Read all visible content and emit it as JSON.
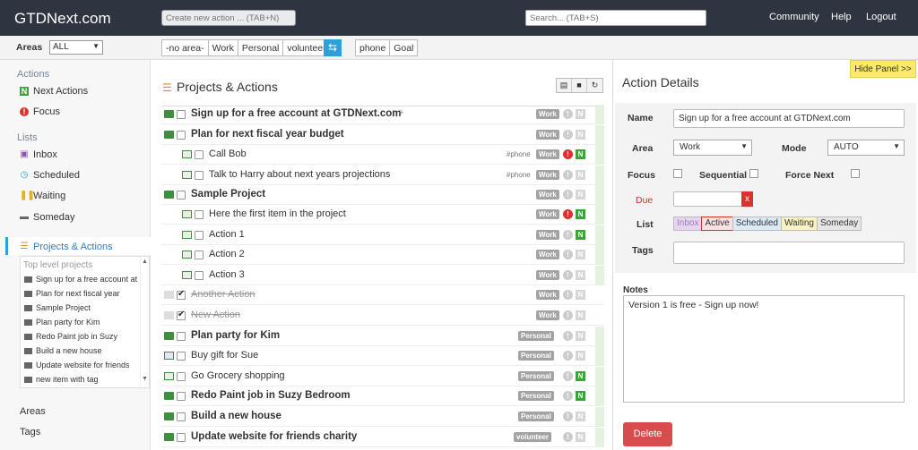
{
  "app": {
    "brand": "GTDNext.com"
  },
  "header": {
    "new_action_placeholder": "Create new action ... (TAB+N)",
    "search_placeholder": "Search... (TAB+S)",
    "links": [
      "Community",
      "Help",
      "Logout"
    ]
  },
  "filters": {
    "areas_label": "Areas",
    "areas_value": "ALL",
    "area_tabs": [
      "-no area-",
      "Work",
      "Personal",
      "volunteer"
    ],
    "shuffle_icon": "shuffle-icon",
    "context_tabs": [
      "phone",
      "Goal"
    ]
  },
  "sidebar": {
    "actions_heading": "Actions",
    "actions_items": [
      "Next Actions",
      "Focus"
    ],
    "lists_heading": "Lists",
    "lists_items": [
      "Inbox",
      "Scheduled",
      "Waiting",
      "Someday"
    ],
    "projects_label": "Projects & Actions",
    "top_level_heading": "Top level projects",
    "projects": [
      "Sign up for a free account at",
      "Plan for next fiscal year",
      "Sample Project",
      "Plan party for Kim",
      "Redo Paint job in Suzy",
      "Build a new house",
      "Update website for friends",
      "new item with tag"
    ],
    "footer_items": [
      "Areas",
      "Tags"
    ]
  },
  "main": {
    "title": "Projects & Actions",
    "rows": [
      {
        "text": "Sign up for a free account at GTDNext.com",
        "kind": "project",
        "tag": "Work",
        "ctx": "",
        "note": true
      },
      {
        "text": "Plan for next fiscal year budget",
        "kind": "project-open",
        "tag": "Work",
        "ctx": ""
      },
      {
        "text": "Call Bob",
        "kind": "action",
        "tag": "Work",
        "ctx": "#phone",
        "focus": true,
        "next": true
      },
      {
        "text": "Talk to Harry about next years projections",
        "kind": "action",
        "tag": "Work",
        "ctx": "#phone"
      },
      {
        "text": "Sample Project",
        "kind": "project-open",
        "tag": "Work",
        "ctx": ""
      },
      {
        "text": "Here the first item in the project",
        "kind": "action",
        "tag": "Work",
        "ctx": "",
        "focus": true,
        "next": true
      },
      {
        "text": "Action 1",
        "kind": "action",
        "tag": "Work",
        "ctx": "",
        "next": true
      },
      {
        "text": "Action 2",
        "kind": "action",
        "tag": "Work",
        "ctx": ""
      },
      {
        "text": "Action 3",
        "kind": "action",
        "tag": "Work",
        "ctx": ""
      },
      {
        "text": "Another Action",
        "kind": "done",
        "tag": "Work",
        "ctx": ""
      },
      {
        "text": "New Action",
        "kind": "done",
        "tag": "Work",
        "ctx": ""
      },
      {
        "text": "Plan party for Kim",
        "kind": "project",
        "tag": "Personal",
        "ctx": ""
      },
      {
        "text": "Buy gift for Sue",
        "kind": "single",
        "tag": "Personal",
        "ctx": ""
      },
      {
        "text": "Go Grocery shopping",
        "kind": "single-green",
        "tag": "Personal",
        "ctx": "",
        "next": true
      },
      {
        "text": "Redo Paint job in Suzy Bedroom",
        "kind": "project",
        "tag": "Personal",
        "ctx": "",
        "next": true
      },
      {
        "text": "Build a new house",
        "kind": "project",
        "tag": "Personal",
        "ctx": ""
      },
      {
        "text": "Update website for friends charity",
        "kind": "project",
        "tag": "volunteer",
        "ctx": ""
      }
    ]
  },
  "details": {
    "hide_panel": "Hide Panel >>",
    "title": "Action Details",
    "name_label": "Name",
    "name_value": "Sign up for a free account at GTDNext.com",
    "area_label": "Area",
    "area_value": "Work",
    "mode_label": "Mode",
    "mode_value": "AUTO",
    "focus_label": "Focus",
    "sequential_label": "Sequential",
    "force_next_label": "Force Next",
    "due_label": "Due",
    "due_clear": "x",
    "list_label": "List",
    "list_options": [
      "Inbox",
      "Active",
      "Scheduled",
      "Waiting",
      "Someday"
    ],
    "list_selected": "Active",
    "tags_label": "Tags",
    "notes_label": "Notes",
    "notes_value": "Version 1 is free - Sign up now!",
    "delete_label": "Delete"
  },
  "colors": {
    "topbar": "#2e3540",
    "accent": "#2f9fd8",
    "next_green": "#3aa33a",
    "focus_red": "#d9342b",
    "delete_red": "#d74d4d",
    "hide_panel_yellow": "#fbe96a"
  }
}
